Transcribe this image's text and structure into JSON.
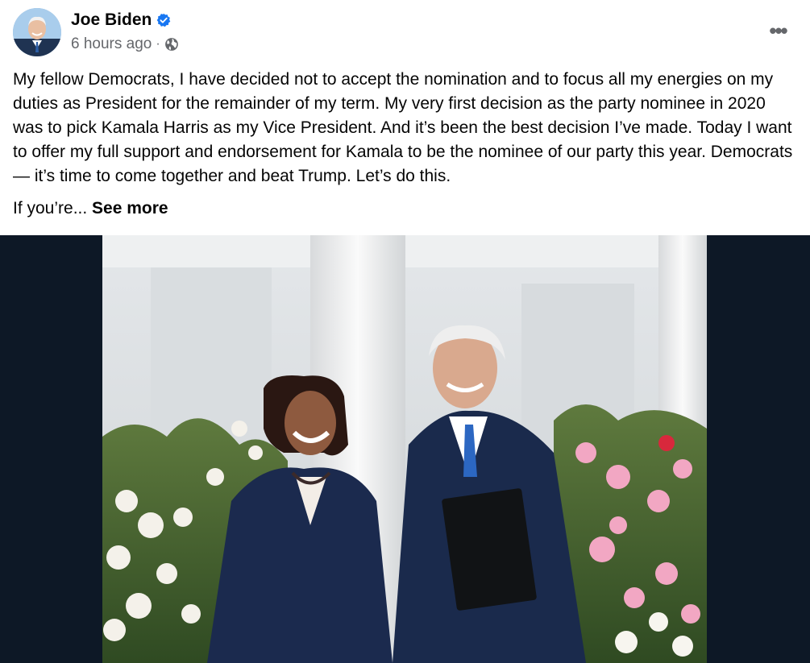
{
  "post": {
    "author": {
      "name": "Joe Biden",
      "verified": true,
      "avatar_icon": "profile-photo"
    },
    "timestamp": "6 hours ago",
    "separator": "·",
    "audience_icon": "globe-icon",
    "menu_label": "•••",
    "text": "My fellow Democrats, I have decided not to accept the nomination and to focus all my energies on my duties as President for the remainder of my term. My very first decision as the party nominee in 2020 was to pick Kamala Harris as my Vice President. And it’s been the best decision I’ve made. Today I want to offer my full support and endorsement for Kamala to be the nominee of our party this year. Democrats — it’s time to come together and beat Trump. Let’s do this.",
    "truncated_text": "If you’re...",
    "see_more_label": "See more"
  },
  "colors": {
    "verified_blue": "#1877f2",
    "meta_gray": "#65676b",
    "media_background": "#0d1826"
  }
}
